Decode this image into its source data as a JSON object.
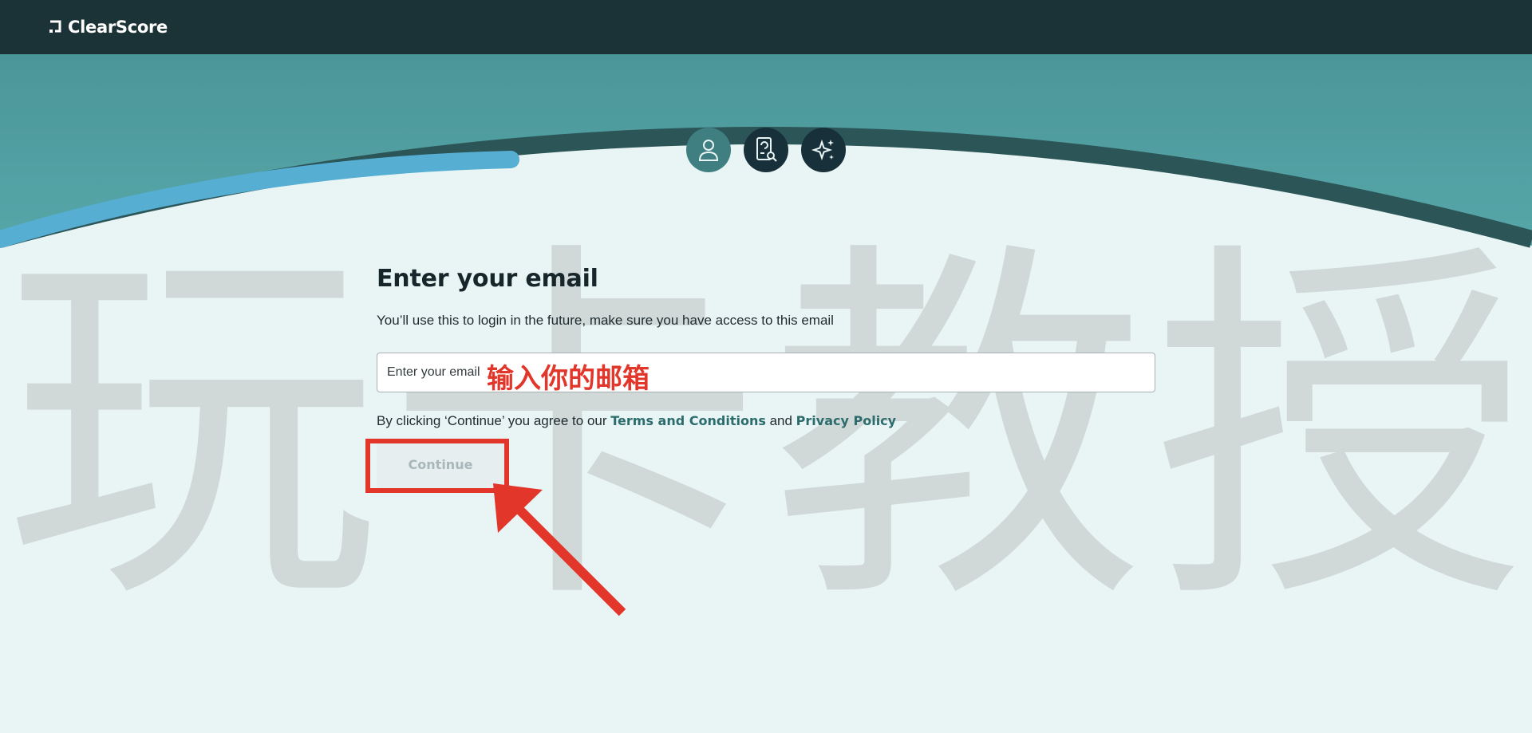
{
  "brand": {
    "name": "ClearScore",
    "logo_icon": "clearscore-logo-mark"
  },
  "colors": {
    "topbar": "#1b3236",
    "accent": "#2d6c6d",
    "annotation": "#e2362a",
    "progress": "#56aed3"
  },
  "progress": {
    "steps": [
      {
        "icon": "user-icon",
        "state": "active"
      },
      {
        "icon": "document-search-icon",
        "state": "pending"
      },
      {
        "icon": "sparkle-icon",
        "state": "pending"
      }
    ],
    "fraction_complete": 0.33
  },
  "form": {
    "title": "Enter your email",
    "subtitle": "You’ll use this to login in the future, make sure you have access to this email",
    "email_placeholder": "Enter your email",
    "email_value": "",
    "consent_prefix": "By clicking ‘Continue’ you agree to our ",
    "terms_link": "Terms and Conditions",
    "consent_and": " and ",
    "privacy_link": "Privacy Policy",
    "continue_label": "Continue"
  },
  "annotation": {
    "input_hint": "输入你的邮箱"
  },
  "watermark": {
    "chars": [
      "玩",
      "卡",
      "教",
      "授"
    ]
  }
}
